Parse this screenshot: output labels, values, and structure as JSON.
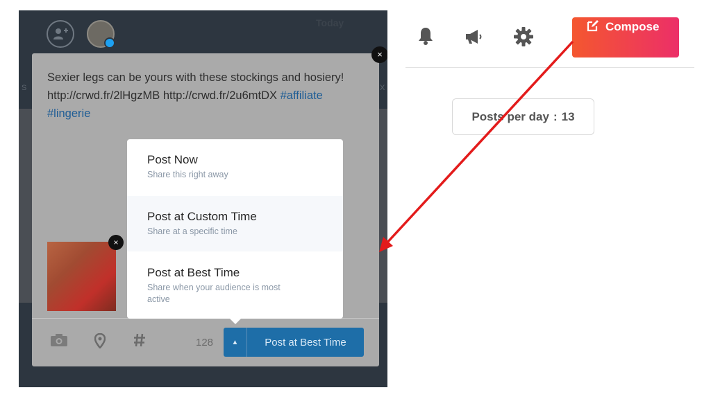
{
  "left": {
    "today_label": "Today",
    "edge_left": "S",
    "edge_right": "X"
  },
  "composer": {
    "text_plain": "Sexier legs can be yours with these stockings and hosiery! http://crwd.fr/2lHgzMB http://crwd.fr/2u6mtDX",
    "hashtags": "#affiliate #lingerie",
    "close_symbol": "×",
    "thumb_close_symbol": "×",
    "char_count": "128",
    "post_button_label": "Post at Best Time",
    "post_button_caret": "▲"
  },
  "menu": {
    "items": [
      {
        "title": "Post Now",
        "subtitle": "Share this right away"
      },
      {
        "title": "Post at Custom Time",
        "subtitle": "Share at a specific time"
      },
      {
        "title": "Post at Best Time",
        "subtitle": "Share when your audience is most active"
      }
    ]
  },
  "right": {
    "compose_label": "Compose",
    "posts_per_day_label": "Posts per day",
    "posts_per_day_sep": ":",
    "posts_per_day_value": "13"
  },
  "icons": [
    "add-user-icon",
    "avatar",
    "twitter-icon",
    "camera-icon",
    "location-icon",
    "hashtag-icon",
    "bell-icon",
    "megaphone-icon",
    "gear-icon",
    "edit-icon",
    "close-icon"
  ],
  "colors": {
    "compose_gradient_start": "#f4572f",
    "compose_gradient_end": "#ec2f68",
    "post_button": "#1e6ea8",
    "annotation_arrow": "#e31b1b"
  }
}
